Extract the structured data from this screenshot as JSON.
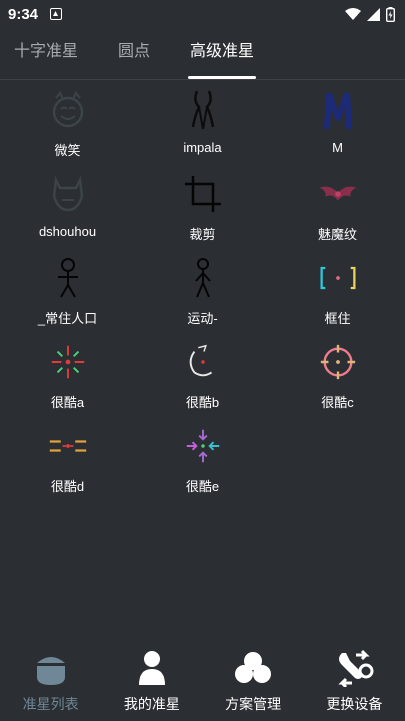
{
  "status_bar": {
    "time": "9:34"
  },
  "tabs": [
    {
      "label": "十字准星",
      "active": false
    },
    {
      "label": "圆点",
      "active": false
    },
    {
      "label": "高级准星",
      "active": true
    }
  ],
  "crosshairs": [
    {
      "label": "微笑",
      "icon": "smiley-face-icon"
    },
    {
      "label": "impala",
      "icon": "impala-horns-icon"
    },
    {
      "label": "M",
      "icon": "letter-m-icon"
    },
    {
      "label": "dshouhou",
      "icon": "beast-mask-icon"
    },
    {
      "label": "裁剪",
      "icon": "crop-icon"
    },
    {
      "label": "魅魔纹",
      "icon": "tribal-wings-icon"
    },
    {
      "label": "_常住人口",
      "icon": "stick-figure-icon"
    },
    {
      "label": "运动-",
      "icon": "running-figure-icon"
    },
    {
      "label": "框住",
      "icon": "bracket-frame-icon"
    },
    {
      "label": "很酷a",
      "icon": "cool-crosshair-a-icon"
    },
    {
      "label": "很酷b",
      "icon": "cool-crosshair-b-icon"
    },
    {
      "label": "很酷c",
      "icon": "cool-crosshair-c-icon"
    },
    {
      "label": "很酷d",
      "icon": "cool-crosshair-d-icon"
    },
    {
      "label": "很酷e",
      "icon": "cool-crosshair-e-icon"
    }
  ],
  "bottom_nav": [
    {
      "label": "准星列表",
      "icon": "crosshair-list-icon",
      "active": true
    },
    {
      "label": "我的准星",
      "icon": "my-crosshair-icon",
      "active": false
    },
    {
      "label": "方案管理",
      "icon": "plan-manage-icon",
      "active": false
    },
    {
      "label": "更换设备",
      "icon": "change-device-icon",
      "active": false
    }
  ],
  "colors": {
    "background": "#2b2f33",
    "accent_inactive_nav": "#6f8796",
    "text": "#ffffff",
    "tab_inactive": "#a7acb2"
  }
}
